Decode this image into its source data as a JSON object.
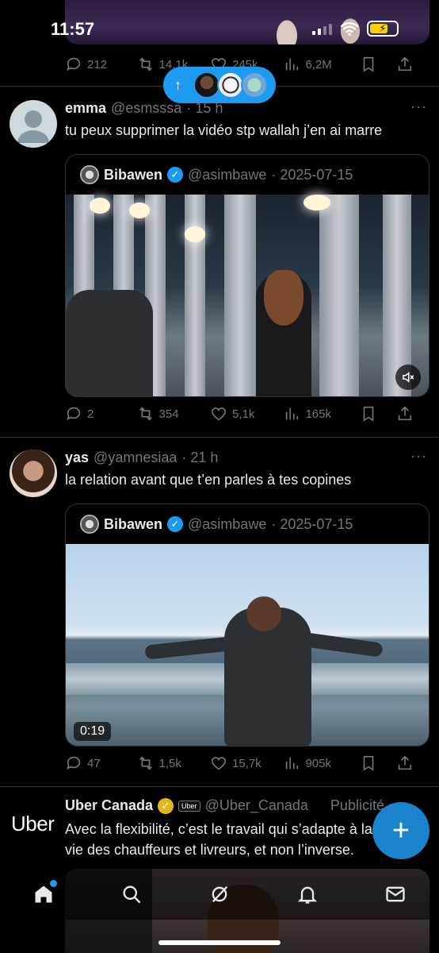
{
  "status_bar": {
    "time": "11:57"
  },
  "tweet0_actions": {
    "replies": "212",
    "retweets": "14,1k",
    "likes": "245k",
    "views": "6,2M"
  },
  "tweet1": {
    "name": "emma",
    "handle": "@esmsssa",
    "time": "· 15 h",
    "text": "tu peux supprimer la vidéo stp wallah j’en ai marre",
    "quote": {
      "name": "Bibawen",
      "handle": "@asimbawe",
      "date": "· 2025-07-15"
    },
    "actions": {
      "replies": "2",
      "retweets": "354",
      "likes": "5,1k",
      "views": "165k"
    }
  },
  "tweet2": {
    "name": "yas",
    "handle": "@yamnesiaa",
    "time": "· 21 h",
    "text": "la relation avant que t’en parles à tes copines",
    "quote": {
      "name": "Bibawen",
      "handle": "@asimbawe",
      "date": "· 2025-07-15",
      "duration": "0:19"
    },
    "actions": {
      "replies": "47",
      "retweets": "1,5k",
      "likes": "15,7k",
      "views": "905k"
    }
  },
  "ad": {
    "logo": "Uber",
    "name": "Uber Canada",
    "badge": "Uber",
    "handle": "@Uber_Canada",
    "label": "Publicité",
    "text_line1": "Avec la flexibilité, c’est le travail qui s’adapte à la",
    "text_line2": "vie des chauffeurs et livreurs, et non l’inverse."
  },
  "colors": {
    "accent": "#1d9bf0",
    "muted": "#71767b",
    "text": "#e7e9ea",
    "background": "#000000"
  }
}
